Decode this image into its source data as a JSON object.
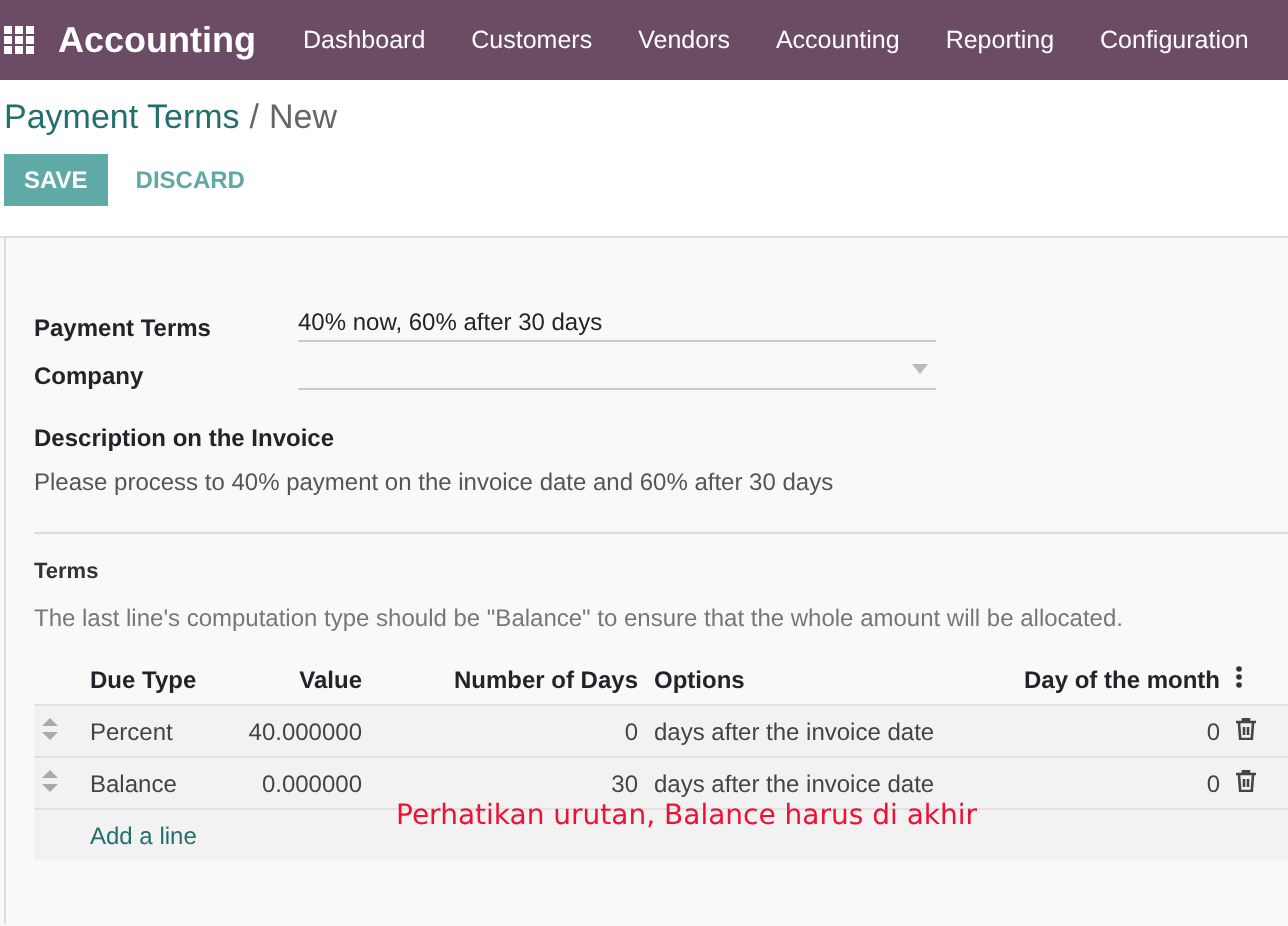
{
  "navbar": {
    "app_name": "Accounting",
    "menu": [
      "Dashboard",
      "Customers",
      "Vendors",
      "Accounting",
      "Reporting",
      "Configuration"
    ]
  },
  "breadcrumb": {
    "parent": "Payment Terms",
    "separator": "/",
    "current": "New"
  },
  "buttons": {
    "save": "SAVE",
    "discard": "DISCARD"
  },
  "form": {
    "fields": [
      {
        "label": "Payment Terms",
        "kind": "text",
        "value": "40% now, 60% after 30 days"
      },
      {
        "label": "Company",
        "kind": "select"
      }
    ],
    "description_label": "Description on the Invoice",
    "description": "Please process to 40% payment on the invoice date and 60% after 30 days"
  },
  "terms": {
    "label": "Terms",
    "hint": "The last line's computation type should be \"Balance\" to ensure that the whole amount will be allocated.",
    "columns": [
      "Due Type",
      "Value",
      "Number of Days",
      "Options",
      "Day of the month"
    ],
    "rows": [
      {
        "due_type": "Percent",
        "value": "40.000000",
        "days": "0",
        "option": "days after the invoice date",
        "day_of_month": "0"
      },
      {
        "due_type": "Balance",
        "value": "0.000000",
        "days": "30",
        "option": "days after the invoice date",
        "day_of_month": "0"
      }
    ],
    "add_line": "Add a line"
  },
  "annotation": "Perhatikan urutan, Balance harus di akhir"
}
